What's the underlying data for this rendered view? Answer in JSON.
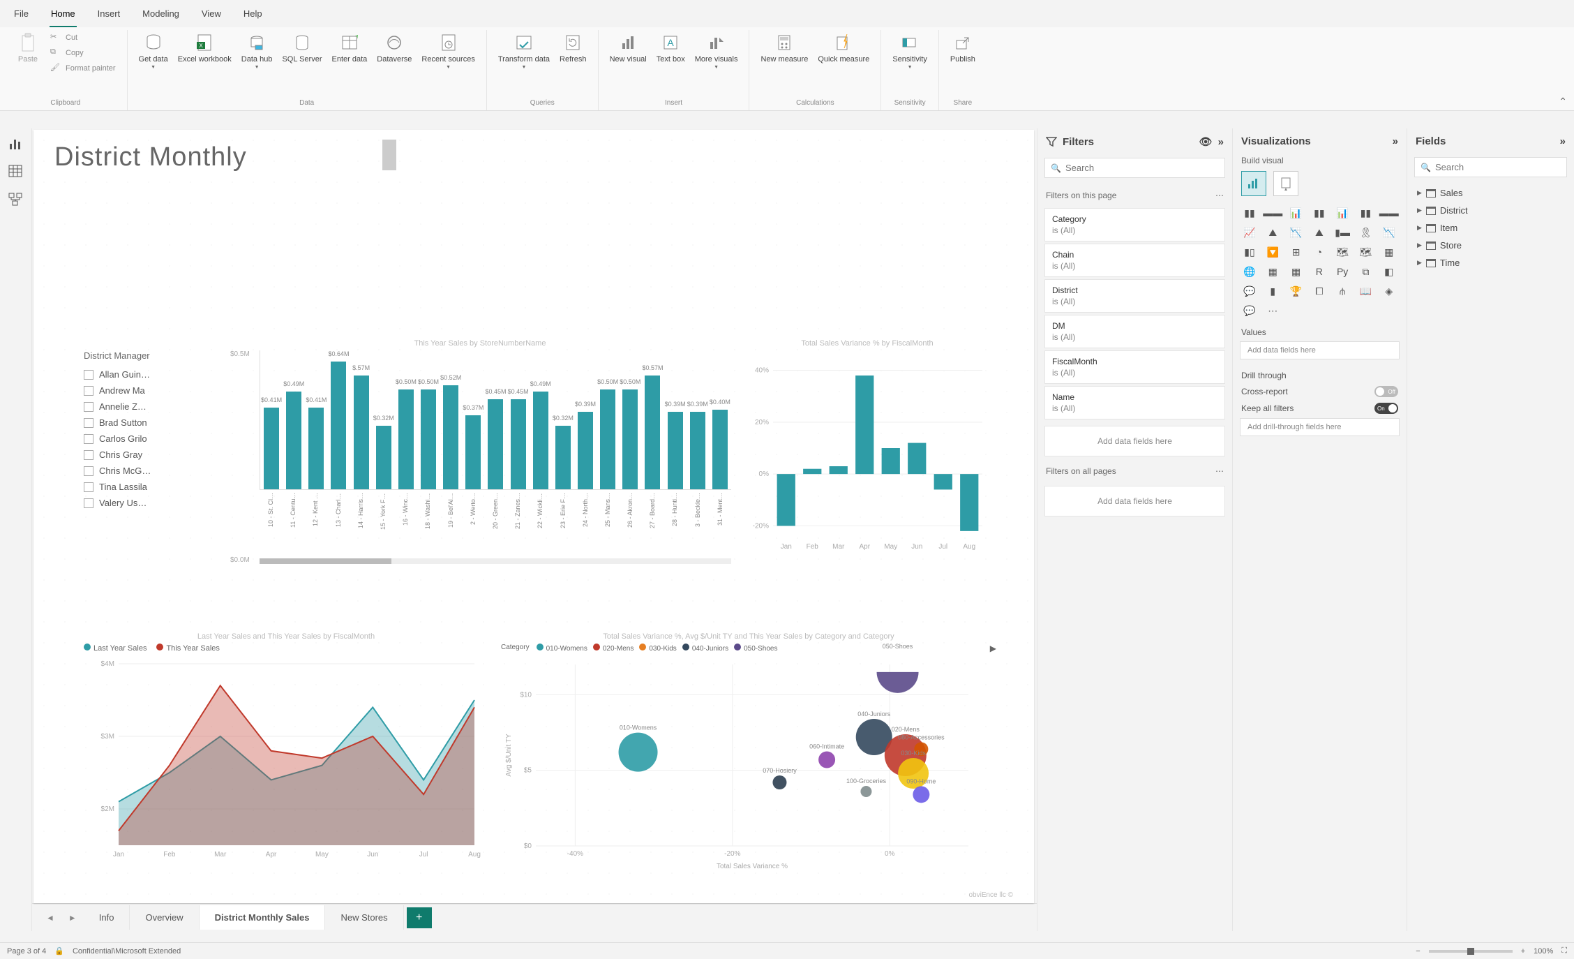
{
  "menubar": {
    "tabs": [
      "File",
      "Home",
      "Insert",
      "Modeling",
      "View",
      "Help"
    ],
    "active": 1
  },
  "ribbon": {
    "clipboard": {
      "label": "Clipboard",
      "paste": "Paste",
      "cut": "Cut",
      "copy": "Copy",
      "format": "Format painter"
    },
    "data": {
      "label": "Data",
      "get": "Get data",
      "excel": "Excel workbook",
      "hub": "Data hub",
      "sql": "SQL Server",
      "enter": "Enter data",
      "dataverse": "Dataverse",
      "recent": "Recent sources"
    },
    "queries": {
      "label": "Queries",
      "transform": "Transform data",
      "refresh": "Refresh"
    },
    "insert": {
      "label": "Insert",
      "newvis": "New visual",
      "textbox": "Text box",
      "more": "More visuals"
    },
    "calc": {
      "label": "Calculations",
      "newmeasure": "New measure",
      "quickmeasure": "Quick measure"
    },
    "sens": {
      "label": "Sensitivity",
      "btn": "Sensitivity"
    },
    "share": {
      "label": "Share",
      "publish": "Publish"
    }
  },
  "page_title": "District Monthly",
  "slicer": {
    "header": "District Manager",
    "items": [
      "Allan Guin…",
      "Andrew Ma",
      "Annelie Z…",
      "Brad Sutton",
      "Carlos Grilo",
      "Chris Gray",
      "Chris McG…",
      "Tina Lassila",
      "Valery Us…"
    ]
  },
  "chart_data": [
    {
      "id": "bar1",
      "type": "bar",
      "title": "This Year Sales by StoreNumberName",
      "ylabel": "",
      "ylim": [
        0,
        0.7
      ],
      "yticks": [
        "$0.5M",
        "$0.0M"
      ],
      "categories": [
        "10 - St. Cl…",
        "11 - Centu…",
        "12 - Kent …",
        "13 - Charl…",
        "14 - Harris…",
        "15 - York F…",
        "16 - Winc…",
        "18 - Washi…",
        "19 - Bel'Al…",
        "2 - Werto…",
        "20 - Green…",
        "21 - Zanes…",
        "22 - Wickli…",
        "23 - Erie F…",
        "24 - North…",
        "25 - Mans…",
        "26 - Akron…",
        "27 - Board…",
        "28 - Hunti…",
        "3 - Beckle…",
        "31 - Ment…"
      ],
      "values": [
        0.41,
        0.49,
        0.41,
        0.64,
        0.57,
        0.32,
        0.5,
        0.5,
        0.52,
        0.37,
        0.45,
        0.45,
        0.49,
        0.32,
        0.39,
        0.5,
        0.5,
        0.57,
        0.39,
        0.39,
        0.4
      ],
      "value_labels": [
        "$0.41M",
        "$0.49M",
        "$0.41M",
        "$0.64M",
        "$.57M",
        "$0.32M",
        "$0.50M",
        "$0.50M",
        "$0.52M",
        "$0.37M",
        "$0.45M",
        "$0.45M",
        "$0.49M",
        "$0.32M",
        "$0.39M",
        "$0.50M",
        "$0.50M",
        "$0.57M",
        "$0.39M",
        "$0.39M",
        "$0.40M"
      ]
    },
    {
      "id": "bar2",
      "type": "bar",
      "title": "Total Sales Variance % by FiscalMonth",
      "ylim": [
        -0.25,
        0.45
      ],
      "yticks": [
        "40%",
        "20%",
        "0%",
        "-20%"
      ],
      "categories": [
        "Jan",
        "Feb",
        "Mar",
        "Apr",
        "May",
        "Jun",
        "Jul",
        "Aug"
      ],
      "values": [
        -0.2,
        0.02,
        0.03,
        0.38,
        0.1,
        0.12,
        -0.06,
        -0.22
      ]
    },
    {
      "id": "area1",
      "type": "area",
      "title": "Last Year Sales and This Year Sales by FiscalMonth",
      "xlabel": "",
      "ylabel": "",
      "legend": [
        "Last Year Sales",
        "This Year Sales"
      ],
      "colors": [
        "#2e9ca6",
        "#c0392b"
      ],
      "categories": [
        "Jan",
        "Feb",
        "Mar",
        "Apr",
        "May",
        "Jun",
        "Jul",
        "Aug"
      ],
      "series": [
        {
          "name": "Last Year Sales",
          "values": [
            2.1,
            2.5,
            3.0,
            2.4,
            2.6,
            3.4,
            2.4,
            3.5
          ]
        },
        {
          "name": "This Year Sales",
          "values": [
            1.7,
            2.6,
            3.7,
            2.8,
            2.7,
            3.0,
            2.2,
            3.4
          ]
        }
      ],
      "yticks": [
        "$4M",
        "$3M",
        "$2M"
      ],
      "ylim": [
        1.5,
        4.0
      ]
    },
    {
      "id": "scat1",
      "type": "scatter",
      "title": "Total Sales Variance %, Avg $/Unit TY and This Year Sales by Category and Category",
      "xlabel": "Total Sales Variance %",
      "ylabel": "Avg $/Unit TY",
      "xlim": [
        -0.45,
        0.1
      ],
      "ylim": [
        0,
        12
      ],
      "xticks": [
        "-40%",
        "-20%",
        "0%"
      ],
      "yticks": [
        "$10",
        "$5",
        "$0"
      ],
      "legend_header": "Category",
      "legend": [
        {
          "name": "010-Womens",
          "color": "#2e9ca6"
        },
        {
          "name": "020-Mens",
          "color": "#c0392b"
        },
        {
          "name": "030-Kids",
          "color": "#e67e22"
        },
        {
          "name": "040-Juniors",
          "color": "#34495e"
        },
        {
          "name": "050-Shoes",
          "color": "#5b4a8a"
        }
      ],
      "points": [
        {
          "label": "010-Womens",
          "x": -0.32,
          "y": 6.2,
          "r": 28,
          "color": "#2e9ca6"
        },
        {
          "label": "050-Shoes",
          "x": 0.01,
          "y": 11.5,
          "r": 30,
          "color": "#5b4a8a",
          "half": true
        },
        {
          "label": "040-Juniors",
          "x": -0.02,
          "y": 7.2,
          "r": 26,
          "color": "#34495e"
        },
        {
          "label": "020-Mens",
          "x": 0.02,
          "y": 6.0,
          "r": 30,
          "color": "#c0392b"
        },
        {
          "label": "080-Accessories",
          "x": 0.04,
          "y": 6.4,
          "r": 10,
          "color": "#d35400"
        },
        {
          "label": "030-Kids",
          "x": 0.03,
          "y": 4.8,
          "r": 22,
          "color": "#f1c40f"
        },
        {
          "label": "060-Intimate",
          "x": -0.08,
          "y": 5.7,
          "r": 12,
          "color": "#8e44ad"
        },
        {
          "label": "070-Hosiery",
          "x": -0.14,
          "y": 4.2,
          "r": 10,
          "color": "#2c3e50"
        },
        {
          "label": "100-Groceries",
          "x": -0.03,
          "y": 3.6,
          "r": 8,
          "color": "#7f8c8d"
        },
        {
          "label": "090-Home",
          "x": 0.04,
          "y": 3.4,
          "r": 12,
          "color": "#6c5ce7"
        }
      ]
    }
  ],
  "footer_note": "obviEnce llc ©",
  "pagetabs": {
    "tabs": [
      "Info",
      "Overview",
      "District Monthly Sales",
      "New Stores"
    ],
    "active": 2
  },
  "filters": {
    "title": "Filters",
    "search_ph": "Search",
    "section_page": "Filters on this page",
    "section_all": "Filters on all pages",
    "cards": [
      {
        "name": "Category",
        "val": "is (All)"
      },
      {
        "name": "Chain",
        "val": "is (All)"
      },
      {
        "name": "District",
        "val": "is (All)"
      },
      {
        "name": "DM",
        "val": "is (All)"
      },
      {
        "name": "FiscalMonth",
        "val": "is (All)"
      },
      {
        "name": "Name",
        "val": "is (All)"
      }
    ],
    "drop": "Add data fields here"
  },
  "vizpane": {
    "title": "Visualizations",
    "sub": "Build visual",
    "values": "Values",
    "values_drop": "Add data fields here",
    "drill": "Drill through",
    "cross": "Cross-report",
    "keep": "Keep all filters",
    "drill_drop": "Add drill-through fields here",
    "off": "Off",
    "on": "On"
  },
  "fieldspane": {
    "title": "Fields",
    "search_ph": "Search",
    "tables": [
      "Sales",
      "District",
      "Item",
      "Store",
      "Time"
    ]
  },
  "statusbar": {
    "page": "Page 3 of 4",
    "sens": "Confidential\\Microsoft Extended",
    "zoom": "100%"
  }
}
